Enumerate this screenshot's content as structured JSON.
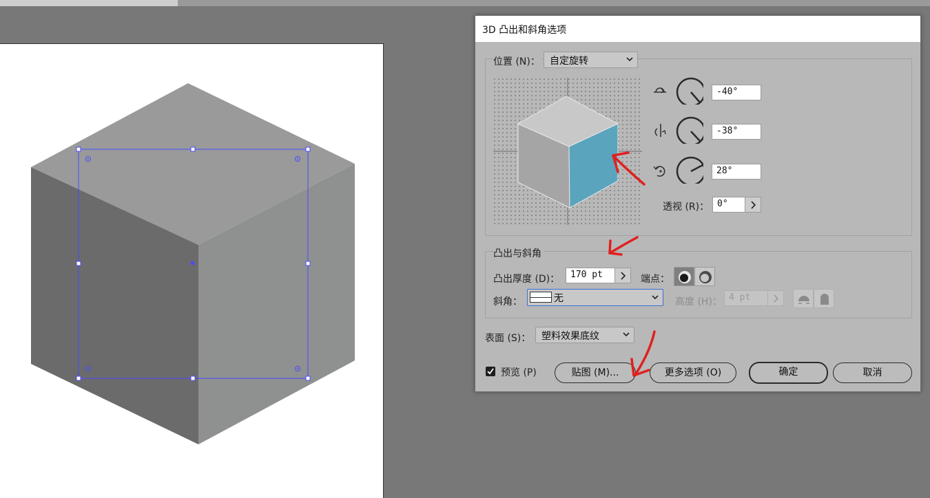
{
  "colors": {
    "canvas_bg": "#787878",
    "artboard": "#ffffff",
    "dialog_bg": "#b8b8b8",
    "cube_top": "#999a99",
    "cube_left": "#6b6b6b",
    "cube_right": "#8f9090",
    "preview_front": "#5aa5bd",
    "selection": "#4a4aff",
    "annotation": "#e02020"
  },
  "dialog": {
    "title": "3D 凸出和斜角选项",
    "position": {
      "label": "位置 (N)：",
      "value": "自定旋转",
      "rotations": [
        {
          "icon": "x-axis-rotate-icon",
          "value": "-40°",
          "angle_deg": -40
        },
        {
          "icon": "y-axis-rotate-icon",
          "value": "-38°",
          "angle_deg": -38
        },
        {
          "icon": "z-axis-rotate-icon",
          "value": "28°",
          "angle_deg": 28
        }
      ],
      "perspective_label": "透视 (R)：",
      "perspective_value": "0°"
    },
    "extrude": {
      "group_label": "凸出与斜角",
      "depth_label": "凸出厚度 (D)：",
      "depth_value": "170 pt",
      "cap_label": "端点：",
      "bevel_label": "斜角：",
      "bevel_value": "无",
      "height_label": "高度 (H)：",
      "height_value": "4 pt"
    },
    "surface": {
      "label": "表面 (S)：",
      "value": "塑料效果底纹"
    },
    "preview_label": "预览 (P)",
    "preview_checked": true,
    "buttons": {
      "map": "贴图 (M)...",
      "more": "更多选项 (O)",
      "ok": "确定",
      "cancel": "取消"
    }
  }
}
